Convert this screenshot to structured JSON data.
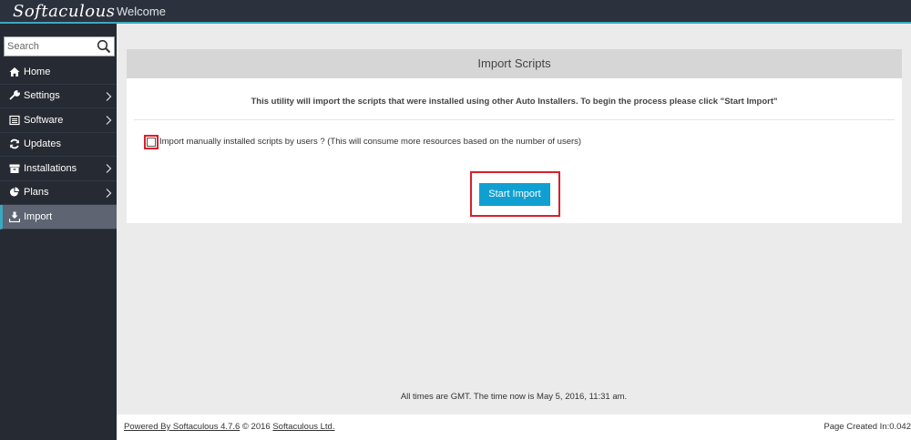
{
  "app": {
    "logo": "Softaculous",
    "welcome": "Welcome"
  },
  "search": {
    "placeholder": "Search",
    "value": ""
  },
  "sidebar": {
    "items": [
      {
        "label": "Home",
        "icon": "home-icon",
        "has_submenu": false
      },
      {
        "label": "Settings",
        "icon": "wrench-icon",
        "has_submenu": true
      },
      {
        "label": "Software",
        "icon": "list-icon",
        "has_submenu": true
      },
      {
        "label": "Updates",
        "icon": "refresh-icon",
        "has_submenu": false
      },
      {
        "label": "Installations",
        "icon": "archive-icon",
        "has_submenu": true
      },
      {
        "label": "Plans",
        "icon": "pie-chart-icon",
        "has_submenu": true
      },
      {
        "label": "Import",
        "icon": "download-icon",
        "has_submenu": false,
        "active": true
      }
    ]
  },
  "main": {
    "title": "Import Scripts",
    "intro": "This utility will import the scripts that were installed using other Auto Installers. To begin the process please click \"Start Import\"",
    "checkbox_label": "Import manually installed scripts by users ? (This will consume more resources based on the number of users)",
    "checkbox_checked": false,
    "start_button": "Start Import"
  },
  "status": {
    "time_text": "All times are GMT. The time now is May 5, 2016, 11:31 am."
  },
  "footer": {
    "powered_by": "Powered By Softaculous 4.7.6",
    "copyright": "© 2016",
    "company": "Softaculous Ltd.",
    "page_created": "Page Created In:0.042"
  },
  "colors": {
    "accent": "#3aa8c1",
    "button": "#0fa0d1",
    "highlight": "#d9202a",
    "sidebar": "#262b33"
  }
}
